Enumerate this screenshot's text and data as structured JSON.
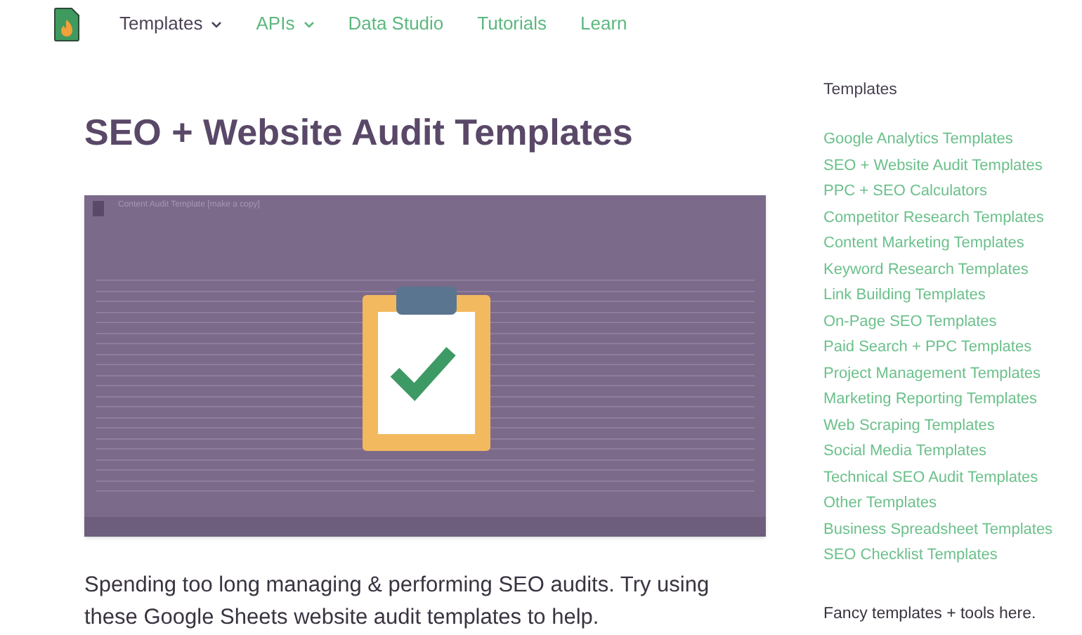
{
  "nav": [
    {
      "label": "Templates",
      "dropdown": true,
      "selected": true
    },
    {
      "label": "APIs",
      "dropdown": true,
      "selected": false
    },
    {
      "label": "Data Studio",
      "dropdown": false,
      "selected": false
    },
    {
      "label": "Tutorials",
      "dropdown": false,
      "selected": false
    },
    {
      "label": "Learn",
      "dropdown": false,
      "selected": false
    }
  ],
  "heading": "SEO + Website Audit Templates",
  "hero_image": {
    "document_title": "Content Audit Template [make a copy]"
  },
  "intro": "Spending too long managing & performing SEO audits. Try using these Google Sheets website audit templates to help.",
  "sidebar": {
    "title": "Templates",
    "links": [
      "Google Analytics Templates",
      "SEO + Website Audit Templates",
      "PPC + SEO Calculators",
      "Competitor Research Templates",
      "Content Marketing Templates",
      "Keyword Research Templates",
      "Link Building Templates",
      "On-Page SEO Templates",
      "Paid Search + PPC Templates",
      "Project Management Templates",
      "Marketing Reporting Templates",
      "Web Scraping Templates",
      "Social Media Templates",
      "Technical SEO Audit Templates",
      "Other Templates",
      "Business Spreadsheet Templates",
      "SEO Checklist Templates"
    ],
    "footer": "Fancy templates + tools here."
  }
}
